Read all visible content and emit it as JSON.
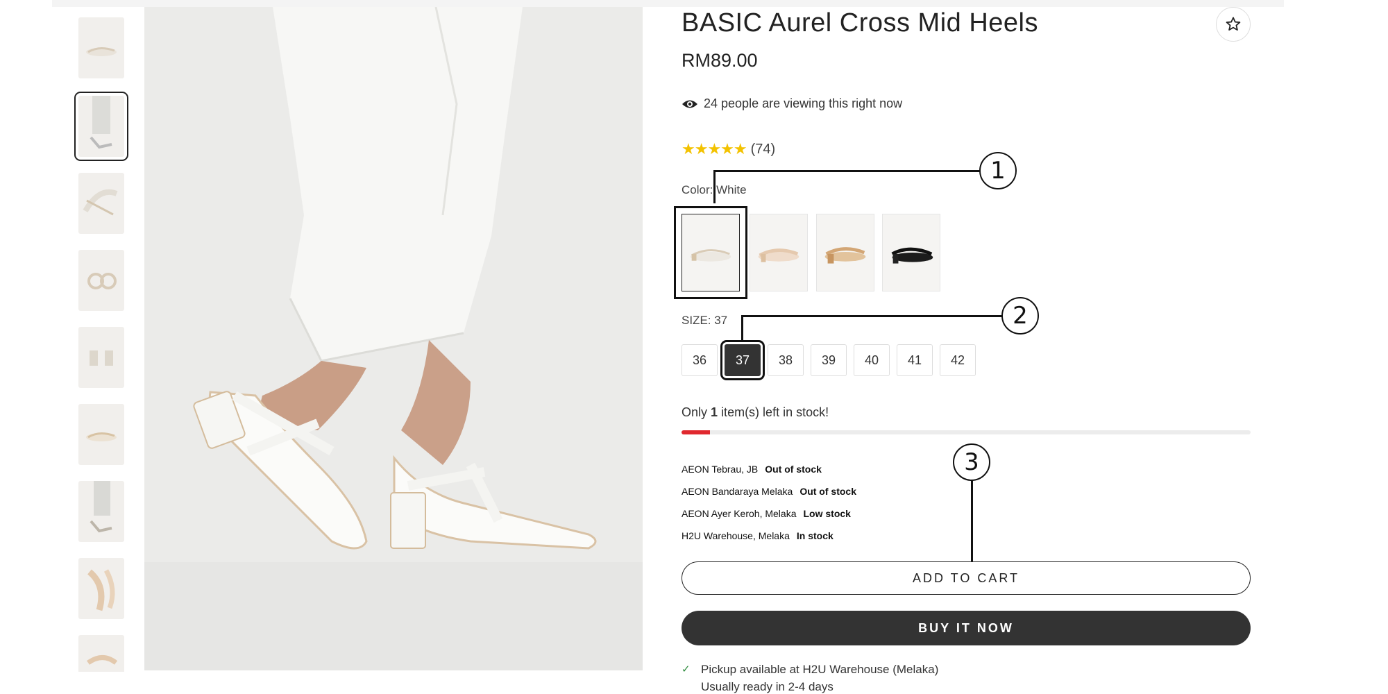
{
  "product": {
    "title": "BASIC Aurel Cross Mid Heels",
    "price": "RM89.00",
    "viewers_text": "24 people are viewing this right now",
    "rating_stars": "★★★★★",
    "rating_count": "(74)",
    "rating_value": 5
  },
  "icons": {
    "eye": "eye-icon",
    "star": "star-outline-icon",
    "check": "check-icon"
  },
  "color": {
    "label": "Color: White",
    "options": [
      "white",
      "nude",
      "tan",
      "black"
    ],
    "selected": "White"
  },
  "size": {
    "label": "SIZE: 37",
    "options": [
      "36",
      "37",
      "38",
      "39",
      "40",
      "41",
      "42"
    ],
    "selected": "37"
  },
  "stock": {
    "prefix": "Only",
    "count": "1",
    "suffix": "item(s) left in stock!",
    "level_fraction": 0.05
  },
  "stores": [
    {
      "name": "AEON Tebrau, JB",
      "status": "Out of stock"
    },
    {
      "name": "AEON Bandaraya Melaka",
      "status": "Out of stock"
    },
    {
      "name": "AEON Ayer Keroh, Melaka",
      "status": "Low stock"
    },
    {
      "name": "H2U Warehouse, Melaka",
      "status": "In stock"
    }
  ],
  "buttons": {
    "add_to_cart": "ADD TO CART",
    "buy_now": "BUY IT NOW"
  },
  "pickup": {
    "line1": "Pickup available at H2U Warehouse (Melaka)",
    "line2": "Usually ready in 2-4 days"
  },
  "callouts": [
    "1",
    "2",
    "3"
  ],
  "colors": {
    "accent_dark": "#333333",
    "stock_red": "#e0282e",
    "star_yellow": "#f3c200",
    "check_green": "#2a8a3a"
  }
}
